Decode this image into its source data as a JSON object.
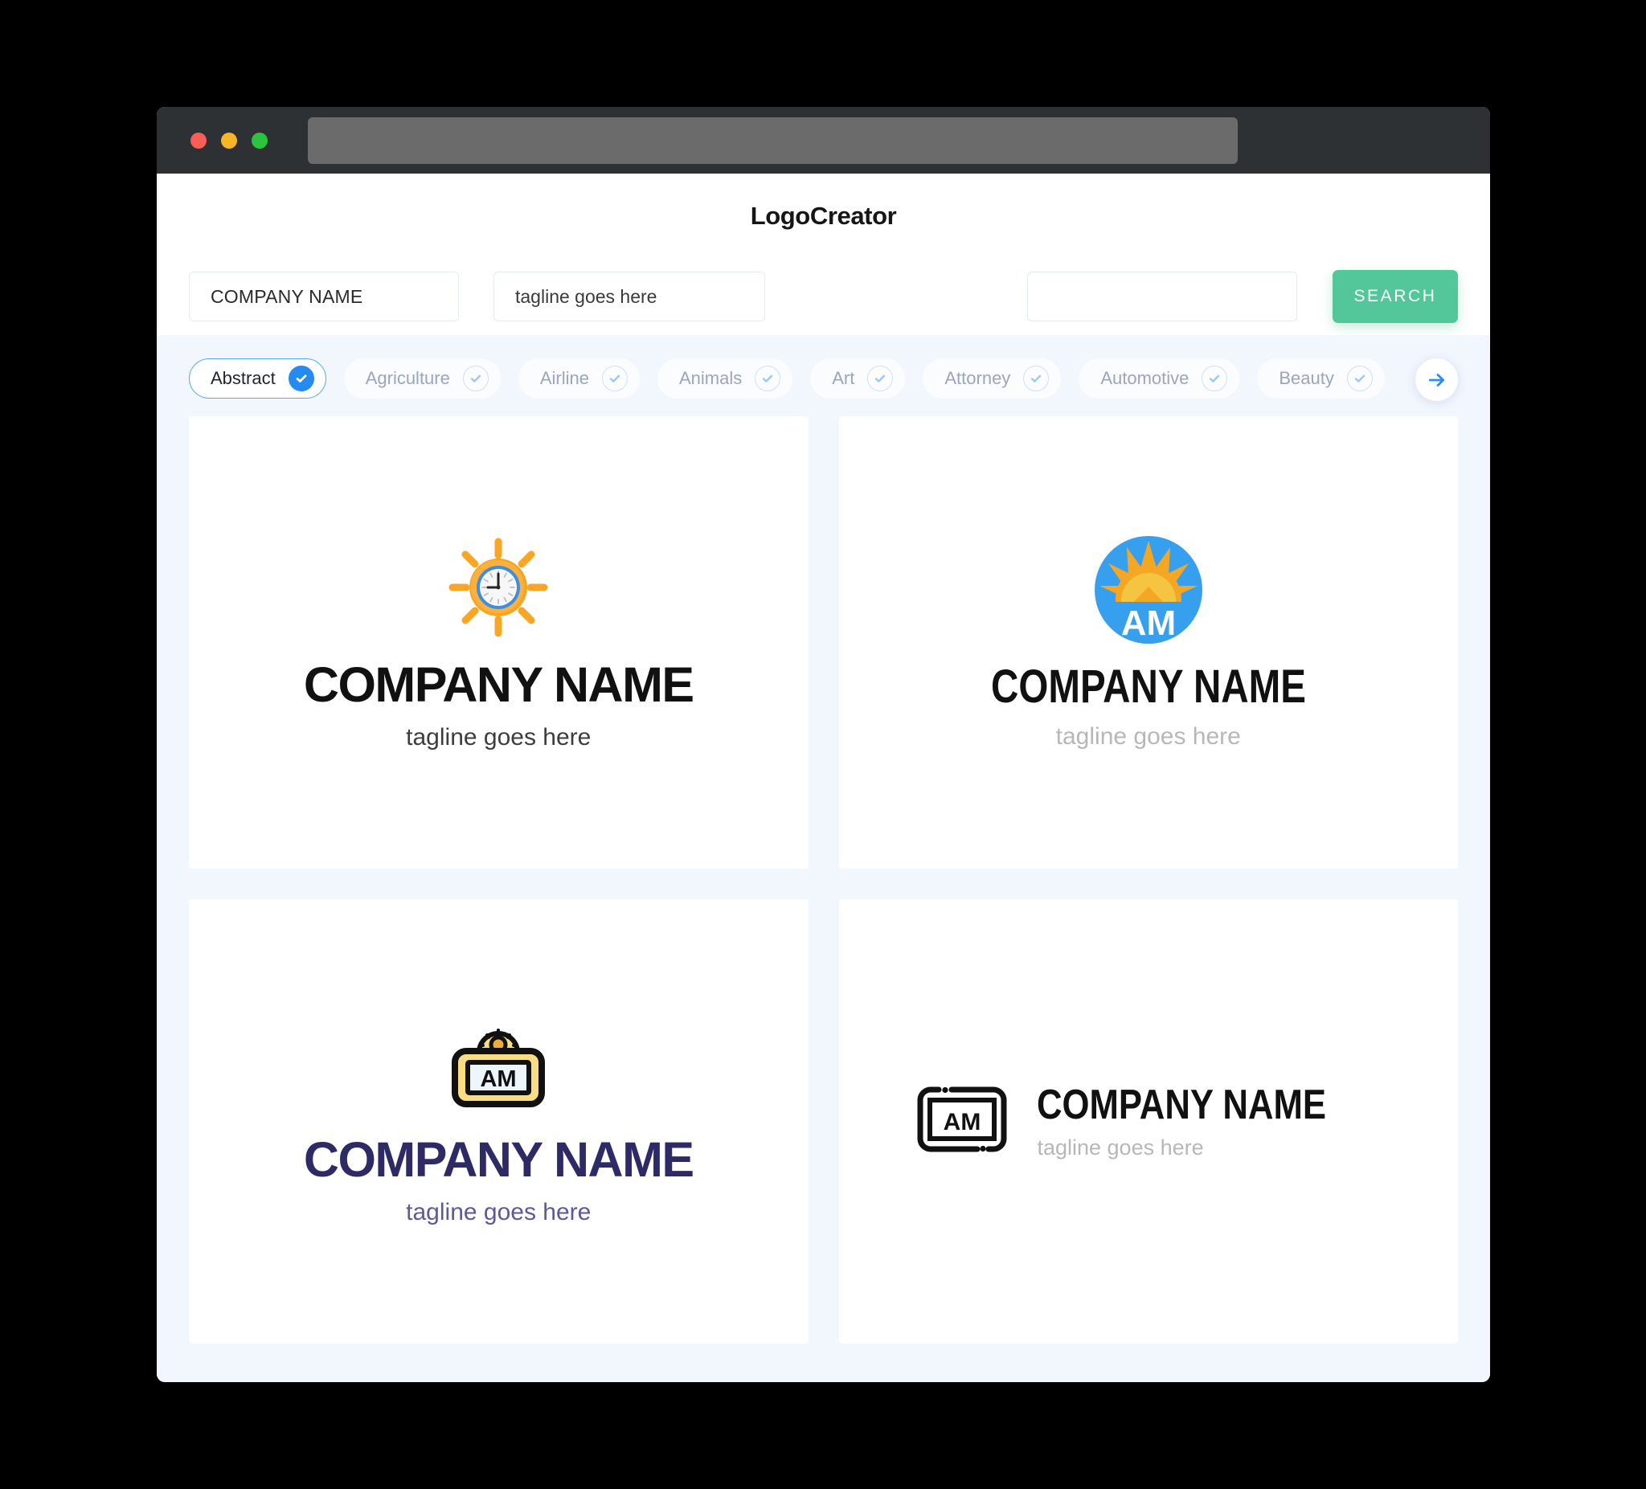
{
  "window": {
    "traffic_lights": [
      "close",
      "minimize",
      "maximize"
    ],
    "url_value": "",
    "chrome_color": "#2e3133",
    "url_bar_color": "#6b6b6b"
  },
  "header": {
    "title": "LogoCreator"
  },
  "search": {
    "company_value": "COMPANY NAME",
    "company_placeholder": "COMPANY NAME",
    "tagline_value": "tagline goes here",
    "tagline_placeholder": "tagline goes here",
    "extra_value": "",
    "extra_placeholder": "",
    "button_label": "SEARCH",
    "button_color": "#54c79a"
  },
  "categories": {
    "accent_color": "#268bf0",
    "next_label": "next",
    "items": [
      {
        "label": "Abstract",
        "selected": true
      },
      {
        "label": "Agriculture",
        "selected": false
      },
      {
        "label": "Airline",
        "selected": false
      },
      {
        "label": "Animals",
        "selected": false
      },
      {
        "label": "Art",
        "selected": false
      },
      {
        "label": "Attorney",
        "selected": false
      },
      {
        "label": "Automotive",
        "selected": false
      },
      {
        "label": "Beauty",
        "selected": false
      }
    ]
  },
  "results": [
    {
      "icon": "sun-clock-icon",
      "name": "COMPANY NAME",
      "tagline": "tagline goes here",
      "name_color": "#111111",
      "tagline_color": "#3d3d3d"
    },
    {
      "icon": "sunrise-circle-am-icon",
      "name": "COMPANY NAME",
      "tagline": "tagline goes here",
      "name_color": "#111111",
      "tagline_color": "#b7b7b7",
      "monogram": "AM"
    },
    {
      "icon": "yellow-sign-am-icon",
      "name": "COMPANY NAME",
      "tagline": "tagline goes here",
      "name_color": "#2d2a66",
      "tagline_color": "#5b5a99",
      "monogram": "AM"
    },
    {
      "icon": "outline-frame-am-icon",
      "name": "COMPANY NAME",
      "tagline": "tagline goes here",
      "name_color": "#111111",
      "tagline_color": "#b7b7b7",
      "monogram": "AM"
    }
  ]
}
